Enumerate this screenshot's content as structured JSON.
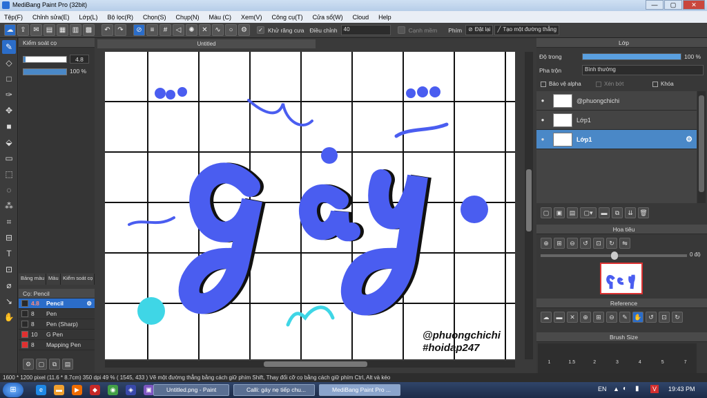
{
  "window": {
    "title": "MediBang Paint Pro (32bit)",
    "min": "—",
    "max": "▢",
    "close": "✕"
  },
  "menu": [
    "Tệp(F)",
    "Chỉnh sửa(E)",
    "Lớp(L)",
    "Bộ lọc(R)",
    "Chọn(S)",
    "Chụp(N)",
    "Màu (C)",
    "Xem(V)",
    "Công cụ(T)",
    "Cửa sổ(W)",
    "Cloud",
    "Help"
  ],
  "toolbar": {
    "antialias_label": "Khử răng cưa",
    "adjust_label": "Điều chỉnh",
    "adjust_value": "40",
    "smooth_label": "Cạnh mềm",
    "snap_label": "Phím",
    "reset_label": "Đặt lại",
    "line_label": "Tạo một đường thẳng"
  },
  "brush_control": {
    "title": "Kiểm soát cọ",
    "size_value": "4.8",
    "opacity_value": "100 %",
    "size_fill": 0.05,
    "opacity_fill": 1.0
  },
  "bottom_tabs": [
    "Bảng màu",
    "Màu",
    "Kiểm soát cọ"
  ],
  "brush_list": {
    "title": "Cọ: Pencil",
    "items": [
      {
        "size": "4.8",
        "name": "Pencil",
        "color": "#2a2a2a"
      },
      {
        "size": "8",
        "name": "Pen",
        "color": "#2a2a2a"
      },
      {
        "size": "8",
        "name": "Pen (Sharp)",
        "color": "#2a2a2a"
      },
      {
        "size": "10",
        "name": "G Pen",
        "color": "#e03030"
      },
      {
        "size": "8",
        "name": "Mapping Pen",
        "color": "#e03030"
      }
    ]
  },
  "document": {
    "tab": "Untitled",
    "signature_line1": "@phuongchichi",
    "signature_line2": "#hoidap247",
    "accent": "#4a5df0",
    "cyan": "#3fd6e6"
  },
  "layer_panel": {
    "title": "Lớp",
    "opacity_label": "Độ trong",
    "opacity_value": "100 %",
    "opacity_fill": 1.0,
    "blend_label": "Pha trộn",
    "blend_value": "Bình thường",
    "protect_alpha": "Bảo vệ alpha",
    "clip": "Xén bớt",
    "lock": "Khóa",
    "layers": [
      {
        "name": "@phuongchichi",
        "selected": false
      },
      {
        "name": "Lớp1",
        "selected": false
      },
      {
        "name": "Lớp1",
        "selected": true
      }
    ]
  },
  "navigator": {
    "title": "Hoa tiêu",
    "angle": "0 độ"
  },
  "reference": {
    "title": "Reference"
  },
  "brush_size": {
    "title": "Brush Size",
    "sizes": [
      "1",
      "1.5",
      "2",
      "3",
      "4",
      "5",
      "7"
    ]
  },
  "status": {
    "text": "1600 * 1200 pixel  (11.6 * 8.7cm)  350 dpi  49 %  ( 1545, 433 )  Vẽ một đường thẳng bằng cách giữ phím Shift, Thay đổi cỡ cọ bằng cách giữ phím Ctrl, Alt và kéo"
  },
  "taskbar": {
    "tasks": [
      "Untitled.png - Paint",
      "Calli: gáy nẹ tiếp chu...",
      "MediBang Paint Pro ..."
    ],
    "lang": "EN",
    "clock": "19:43 PM"
  }
}
